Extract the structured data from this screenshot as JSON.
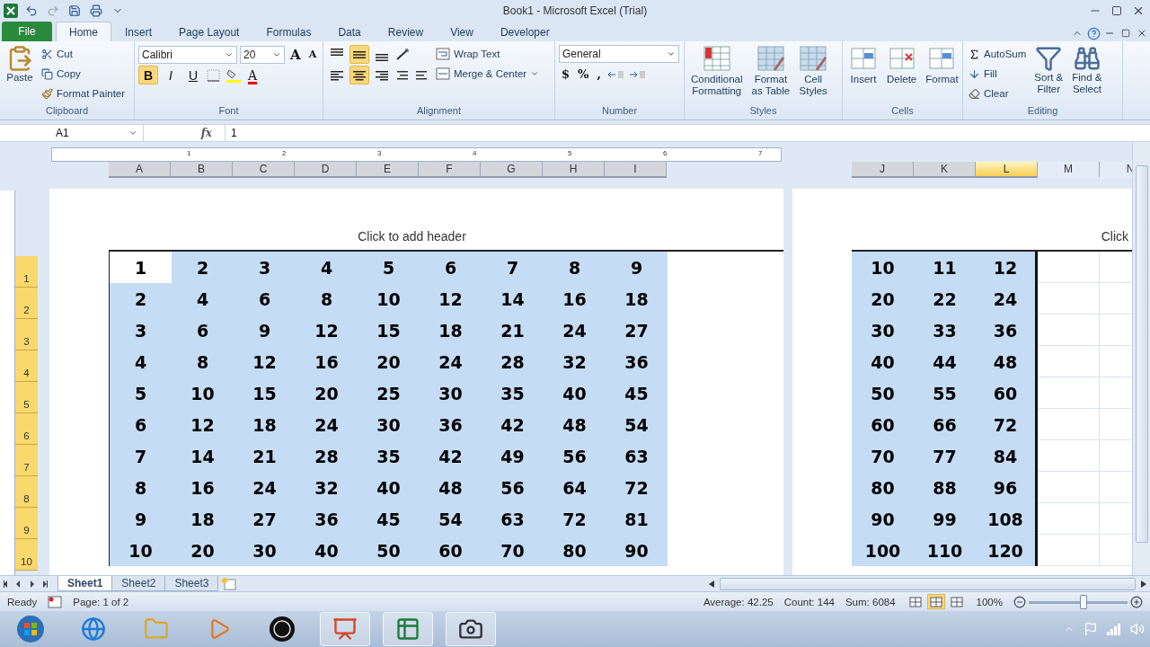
{
  "title_bar": {
    "title": "Book1  -  Microsoft Excel (Trial)"
  },
  "tabs": [
    {
      "label": "File",
      "kind": "file",
      "selected": false
    },
    {
      "label": "Home",
      "kind": "tab",
      "selected": true
    },
    {
      "label": "Insert",
      "kind": "tab",
      "selected": false
    },
    {
      "label": "Page Layout",
      "kind": "tab",
      "selected": false
    },
    {
      "label": "Formulas",
      "kind": "tab",
      "selected": false
    },
    {
      "label": "Data",
      "kind": "tab",
      "selected": false
    },
    {
      "label": "Review",
      "kind": "tab",
      "selected": false
    },
    {
      "label": "View",
      "kind": "tab",
      "selected": false
    },
    {
      "label": "Developer",
      "kind": "tab",
      "selected": false
    }
  ],
  "ribbon": {
    "clipboard": {
      "label": "Clipboard",
      "paste": "Paste",
      "cut": "Cut",
      "copy": "Copy",
      "format_painter": "Format Painter"
    },
    "font": {
      "label": "Font",
      "name": "Calibri",
      "size": "20",
      "grow": "A",
      "shrink": "A",
      "bold": {
        "glyph": "B",
        "selected": true
      },
      "italic": {
        "glyph": "I",
        "selected": false
      },
      "underline": {
        "glyph": "U",
        "selected": false
      },
      "font_color_glyph": "A"
    },
    "alignment": {
      "label": "Alignment",
      "wrap_text": "Wrap Text",
      "merge": "Merge & Center",
      "vertical": [
        {
          "selected": false
        },
        {
          "selected": true
        },
        {
          "selected": false
        }
      ],
      "horizontal": [
        {
          "selected": false
        },
        {
          "selected": true
        },
        {
          "selected": false
        }
      ]
    },
    "number": {
      "label": "Number",
      "format": "General",
      "currency": "$",
      "percent": "%",
      "comma": ","
    },
    "styles": {
      "label": "Styles",
      "buttons": [
        {
          "lines": [
            "Conditional",
            "Formatting"
          ]
        },
        {
          "lines": [
            "Format",
            "as Table"
          ]
        },
        {
          "lines": [
            "Cell",
            "Styles"
          ]
        }
      ]
    },
    "cells": {
      "label": "Cells",
      "buttons": [
        "Insert",
        "Delete",
        "Format"
      ]
    },
    "editing": {
      "label": "Editing",
      "autosum": "AutoSum",
      "fill": "Fill",
      "clear": "Clear",
      "sort": [
        "Sort &",
        "Filter"
      ],
      "find": [
        "Find &",
        "Select"
      ]
    }
  },
  "formula_bar": {
    "name_box": "A1",
    "function_label": "fx",
    "value": "1"
  },
  "ruler": [
    "1",
    "2",
    "3",
    "4",
    "5",
    "6",
    "7"
  ],
  "row_headers": [
    {
      "label": "1",
      "selected": true
    },
    {
      "label": "2",
      "selected": true
    },
    {
      "label": "3",
      "selected": true
    },
    {
      "label": "4",
      "selected": true
    },
    {
      "label": "5",
      "selected": true
    },
    {
      "label": "6",
      "selected": true
    },
    {
      "label": "7",
      "selected": true
    },
    {
      "label": "8",
      "selected": true
    },
    {
      "label": "9",
      "selected": true
    },
    {
      "label": "10",
      "selected": true
    }
  ],
  "pages": [
    {
      "header": "Click to add header",
      "columns": [
        {
          "label": "A",
          "selected": true,
          "hovered": false
        },
        {
          "label": "B",
          "selected": true,
          "hovered": false
        },
        {
          "label": "C",
          "selected": true,
          "hovered": false
        },
        {
          "label": "D",
          "selected": true,
          "hovered": false
        },
        {
          "label": "E",
          "selected": true,
          "hovered": false
        },
        {
          "label": "F",
          "selected": true,
          "hovered": false
        },
        {
          "label": "G",
          "selected": true,
          "hovered": false
        },
        {
          "label": "H",
          "selected": true,
          "hovered": false
        },
        {
          "label": "I",
          "selected": true,
          "hovered": false
        }
      ],
      "rows": [
        [
          {
            "t": "1",
            "active": true
          },
          {
            "t": "2",
            "active": false
          },
          {
            "t": "3",
            "active": false
          },
          {
            "t": "4",
            "active": false
          },
          {
            "t": "5",
            "active": false
          },
          {
            "t": "6",
            "active": false
          },
          {
            "t": "7",
            "active": false
          },
          {
            "t": "8",
            "active": false
          },
          {
            "t": "9",
            "active": false
          }
        ],
        [
          {
            "t": "2",
            "active": false
          },
          {
            "t": "4",
            "active": false
          },
          {
            "t": "6",
            "active": false
          },
          {
            "t": "8",
            "active": false
          },
          {
            "t": "10",
            "active": false
          },
          {
            "t": "12",
            "active": false
          },
          {
            "t": "14",
            "active": false
          },
          {
            "t": "16",
            "active": false
          },
          {
            "t": "18",
            "active": false
          }
        ],
        [
          {
            "t": "3",
            "active": false
          },
          {
            "t": "6",
            "active": false
          },
          {
            "t": "9",
            "active": false
          },
          {
            "t": "12",
            "active": false
          },
          {
            "t": "15",
            "active": false
          },
          {
            "t": "18",
            "active": false
          },
          {
            "t": "21",
            "active": false
          },
          {
            "t": "24",
            "active": false
          },
          {
            "t": "27",
            "active": false
          }
        ],
        [
          {
            "t": "4",
            "active": false
          },
          {
            "t": "8",
            "active": false
          },
          {
            "t": "12",
            "active": false
          },
          {
            "t": "16",
            "active": false
          },
          {
            "t": "20",
            "active": false
          },
          {
            "t": "24",
            "active": false
          },
          {
            "t": "28",
            "active": false
          },
          {
            "t": "32",
            "active": false
          },
          {
            "t": "36",
            "active": false
          }
        ],
        [
          {
            "t": "5",
            "active": false
          },
          {
            "t": "10",
            "active": false
          },
          {
            "t": "15",
            "active": false
          },
          {
            "t": "20",
            "active": false
          },
          {
            "t": "25",
            "active": false
          },
          {
            "t": "30",
            "active": false
          },
          {
            "t": "35",
            "active": false
          },
          {
            "t": "40",
            "active": false
          },
          {
            "t": "45",
            "active": false
          }
        ],
        [
          {
            "t": "6",
            "active": false
          },
          {
            "t": "12",
            "active": false
          },
          {
            "t": "18",
            "active": false
          },
          {
            "t": "24",
            "active": false
          },
          {
            "t": "30",
            "active": false
          },
          {
            "t": "36",
            "active": false
          },
          {
            "t": "42",
            "active": false
          },
          {
            "t": "48",
            "active": false
          },
          {
            "t": "54",
            "active": false
          }
        ],
        [
          {
            "t": "7",
            "active": false
          },
          {
            "t": "14",
            "active": false
          },
          {
            "t": "21",
            "active": false
          },
          {
            "t": "28",
            "active": false
          },
          {
            "t": "35",
            "active": false
          },
          {
            "t": "42",
            "active": false
          },
          {
            "t": "49",
            "active": false
          },
          {
            "t": "56",
            "active": false
          },
          {
            "t": "63",
            "active": false
          }
        ],
        [
          {
            "t": "8",
            "active": false
          },
          {
            "t": "16",
            "active": false
          },
          {
            "t": "24",
            "active": false
          },
          {
            "t": "32",
            "active": false
          },
          {
            "t": "40",
            "active": false
          },
          {
            "t": "48",
            "active": false
          },
          {
            "t": "56",
            "active": false
          },
          {
            "t": "64",
            "active": false
          },
          {
            "t": "72",
            "active": false
          }
        ],
        [
          {
            "t": "9",
            "active": false
          },
          {
            "t": "18",
            "active": false
          },
          {
            "t": "27",
            "active": false
          },
          {
            "t": "36",
            "active": false
          },
          {
            "t": "45",
            "active": false
          },
          {
            "t": "54",
            "active": false
          },
          {
            "t": "63",
            "active": false
          },
          {
            "t": "72",
            "active": false
          },
          {
            "t": "81",
            "active": false
          }
        ],
        [
          {
            "t": "10",
            "active": false
          },
          {
            "t": "20",
            "active": false
          },
          {
            "t": "30",
            "active": false
          },
          {
            "t": "40",
            "active": false
          },
          {
            "t": "50",
            "active": false
          },
          {
            "t": "60",
            "active": false
          },
          {
            "t": "70",
            "active": false
          },
          {
            "t": "80",
            "active": false
          },
          {
            "t": "90",
            "active": false
          }
        ]
      ]
    },
    {
      "header": "Click",
      "columns": [
        {
          "label": "J",
          "selected": true,
          "hovered": false
        },
        {
          "label": "K",
          "selected": true,
          "hovered": false
        },
        {
          "label": "L",
          "selected": true,
          "hovered": true
        },
        {
          "label": "M",
          "selected": false,
          "hovered": false
        },
        {
          "label": "N",
          "selected": false,
          "hovered": false
        }
      ],
      "rows": [
        [
          {
            "t": "10",
            "active": false
          },
          {
            "t": "11",
            "active": false
          },
          {
            "t": "12",
            "active": false
          }
        ],
        [
          {
            "t": "20",
            "active": false
          },
          {
            "t": "22",
            "active": false
          },
          {
            "t": "24",
            "active": false
          }
        ],
        [
          {
            "t": "30",
            "active": false
          },
          {
            "t": "33",
            "active": false
          },
          {
            "t": "36",
            "active": false
          }
        ],
        [
          {
            "t": "40",
            "active": false
          },
          {
            "t": "44",
            "active": false
          },
          {
            "t": "48",
            "active": false
          }
        ],
        [
          {
            "t": "50",
            "active": false
          },
          {
            "t": "55",
            "active": false
          },
          {
            "t": "60",
            "active": false
          }
        ],
        [
          {
            "t": "60",
            "active": false
          },
          {
            "t": "66",
            "active": false
          },
          {
            "t": "72",
            "active": false
          }
        ],
        [
          {
            "t": "70",
            "active": false
          },
          {
            "t": "77",
            "active": false
          },
          {
            "t": "84",
            "active": false
          }
        ],
        [
          {
            "t": "80",
            "active": false
          },
          {
            "t": "88",
            "active": false
          },
          {
            "t": "96",
            "active": false
          }
        ],
        [
          {
            "t": "90",
            "active": false
          },
          {
            "t": "99",
            "active": false
          },
          {
            "t": "108",
            "active": false
          }
        ],
        [
          {
            "t": "100",
            "active": false
          },
          {
            "t": "110",
            "active": false
          },
          {
            "t": "120",
            "active": false
          }
        ]
      ]
    }
  ],
  "sheet_tabs": [
    {
      "label": "Sheet1",
      "selected": true
    },
    {
      "label": "Sheet2",
      "selected": false
    },
    {
      "label": "Sheet3",
      "selected": false
    }
  ],
  "status_bar": {
    "mode": "Ready",
    "page": "Page: 1 of 2",
    "average": "Average: 42.25",
    "count": "Count: 144",
    "sum": "Sum: 6084",
    "views": [
      {
        "selected": false
      },
      {
        "selected": true
      },
      {
        "selected": false
      }
    ],
    "zoom": "100%",
    "zoom_slider": {
      "level": 0.55
    }
  },
  "taskbar": {
    "items": [
      {
        "running": false
      },
      {
        "running": false
      },
      {
        "running": false
      },
      {
        "running": false
      },
      {
        "running": false
      },
      {
        "running": true
      },
      {
        "running": true
      },
      {
        "running": true
      }
    ]
  }
}
